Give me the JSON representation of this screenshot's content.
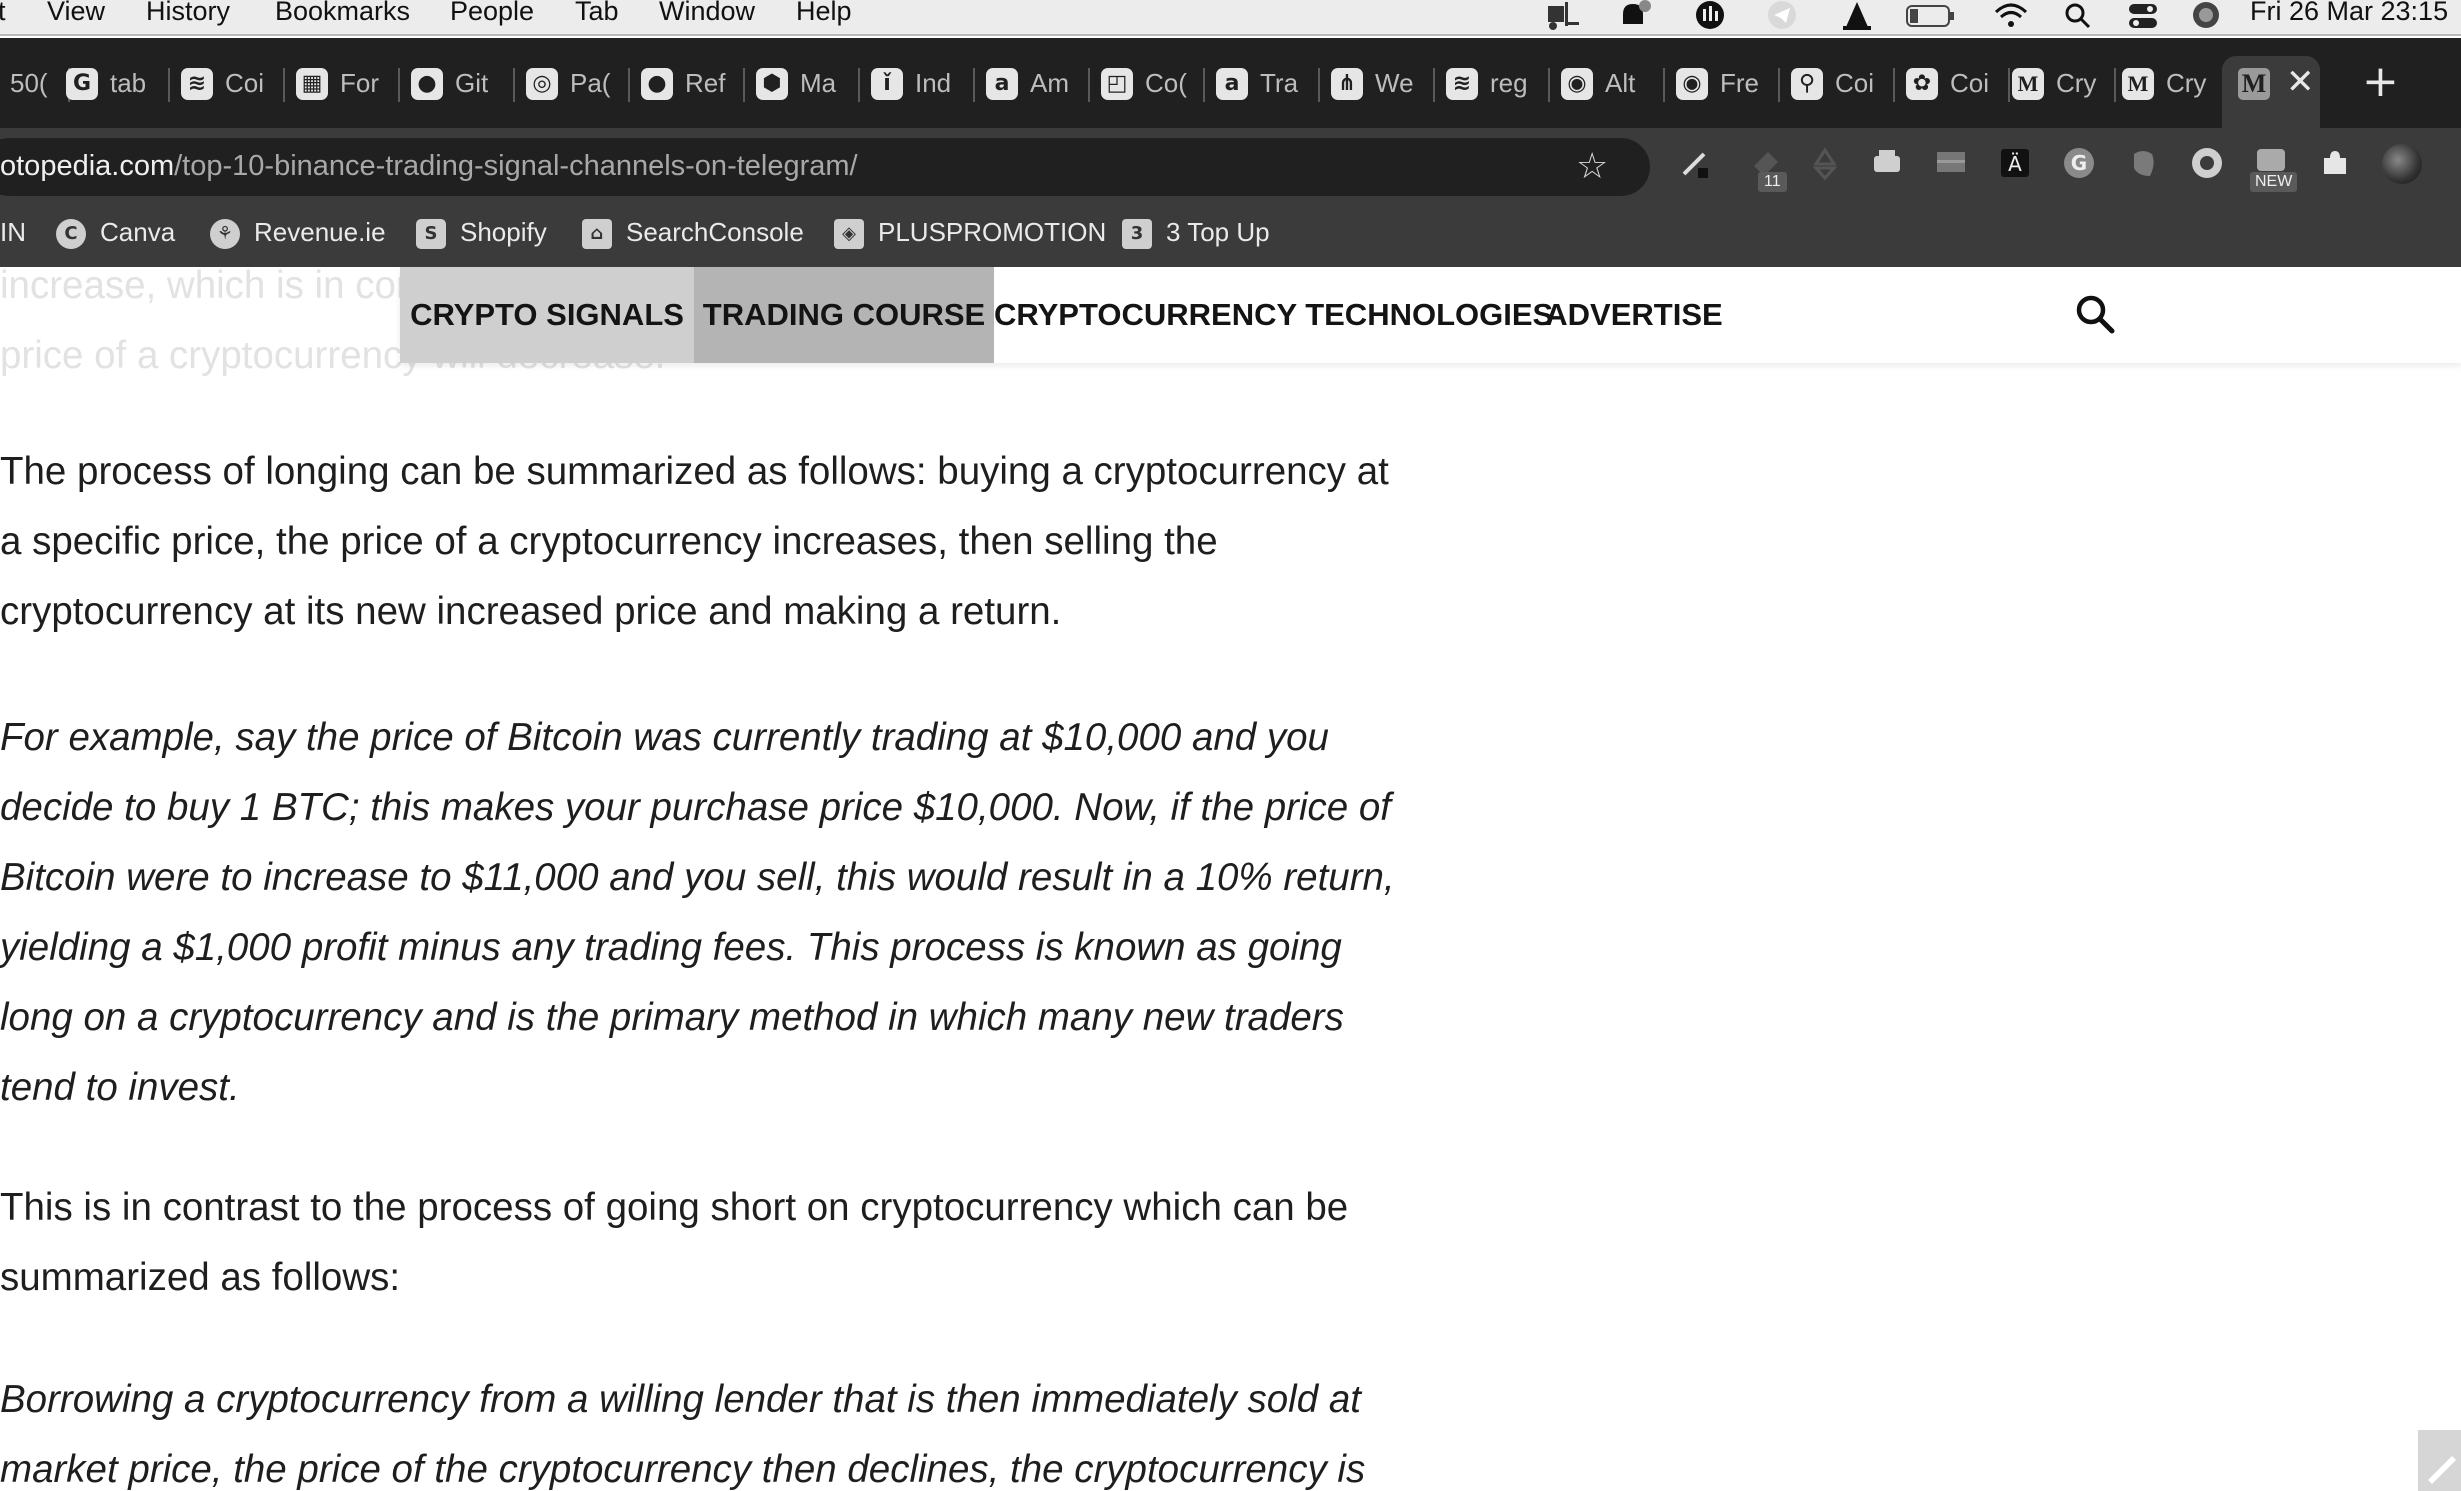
{
  "menubar": {
    "items": [
      "t",
      "View",
      "History",
      "Bookmarks",
      "People",
      "Tab",
      "Window",
      "Help"
    ],
    "clock": "Fri 26 Mar  23:15"
  },
  "tabs": [
    {
      "favicon": "◐",
      "title": "50("
    },
    {
      "favicon": "G",
      "title": "tab"
    },
    {
      "favicon": "≋",
      "title": "Coi"
    },
    {
      "favicon": "▦",
      "title": "For"
    },
    {
      "favicon": "●",
      "title": "Git"
    },
    {
      "favicon": "◎",
      "title": "Pa("
    },
    {
      "favicon": "●",
      "title": "Ref"
    },
    {
      "favicon": "⬢",
      "title": "Ma"
    },
    {
      "favicon": "ǐ",
      "title": "Ind"
    },
    {
      "favicon": "a",
      "title": "Am"
    },
    {
      "favicon": "◰",
      "title": "Co("
    },
    {
      "favicon": "a",
      "title": "Tra"
    },
    {
      "favicon": "⋔",
      "title": "We"
    },
    {
      "favicon": "≋",
      "title": "reg"
    },
    {
      "favicon": "◉",
      "title": "Alt"
    },
    {
      "favicon": "◉",
      "title": "Fre"
    },
    {
      "favicon": "⚲",
      "title": "Coi"
    },
    {
      "favicon": "✿",
      "title": "Coi"
    },
    {
      "favicon": "M",
      "title": "Cry"
    },
    {
      "favicon": "M",
      "title": "Cry"
    }
  ],
  "active_tab": {
    "favicon": "M",
    "close": "✕"
  },
  "new_tab": "+",
  "address_bar": {
    "host": "otopedia.com",
    "path": "/top-10-binance-trading-signal-channels-on-telegram/",
    "star": "☆"
  },
  "extension_badges": {
    "count": "11",
    "new": "NEW"
  },
  "bookmarks": [
    {
      "icon": "",
      "label": "IN"
    },
    {
      "icon": "C",
      "label": "Canva"
    },
    {
      "icon": "⚘",
      "label": "Revenue.ie"
    },
    {
      "icon": "S",
      "label": "Shopify"
    },
    {
      "icon": "⌂",
      "label": "SearchConsole"
    },
    {
      "icon": "◈",
      "label": "PLUSPROMOTION"
    },
    {
      "icon": "3",
      "label": "3 Top Up"
    }
  ],
  "article": {
    "faded_line_1": "increase, which is in contrast to people speculating that the",
    "faded_line_2": "price of a cryptocurrency will decrease.",
    "p1": "The process of longing can be summarized as follows: buying a cryptocurrency at a specific price, the price of a cryptocurrency increases, then selling the cryptocurrency at its new increased price and making a return.",
    "p2": "For example, say the price of Bitcoin was currently trading at $10,000 and you decide to buy 1 BTC; this makes your purchase price $10,000. Now, if the price of Bitcoin were to increase to $11,000 and you sell, this would result in a 10% return, yielding a $1,000 profit minus any trading fees. This process is known as going long on a cryptocurrency and is the primary method in which many new traders tend to invest.",
    "p3": "This is in contrast to the process of going short on cryptocurrency which can be summarized as follows:",
    "p4": "Borrowing a cryptocurrency from a willing lender that is then immediately sold at market price, the price of the cryptocurrency then declines, the cryptocurrency is"
  },
  "site_nav": {
    "items": [
      "CRYPTO SIGNALS",
      "TRADING COURSE",
      "CRYPTOCURRENCY TECHNOLOGIES",
      "ADVERTISE"
    ]
  },
  "colors": {
    "menubar_bg": "#ececec",
    "tabstrip_bg": "#202020",
    "toolbar_bg": "#3b3b3b",
    "nav_hover_1": "#cfcfcf",
    "nav_hover_2": "#b4b4b4",
    "text": "#1e1e1e"
  }
}
